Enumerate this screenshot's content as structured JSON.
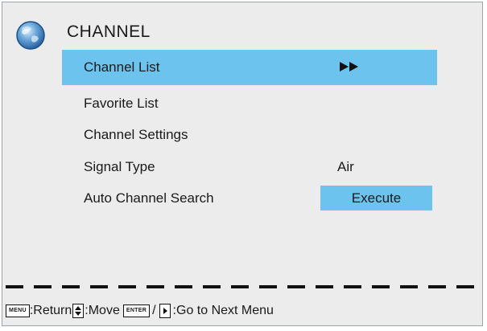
{
  "header": {
    "title": "CHANNEL",
    "icon": "globe-icon"
  },
  "menu": {
    "items": [
      {
        "label": "Channel List",
        "value": "",
        "selected": true,
        "indicator": "►►"
      },
      {
        "label": "Favorite List",
        "value": ""
      },
      {
        "label": "Channel Settings",
        "value": ""
      },
      {
        "label": "Signal Type",
        "value": "Air"
      },
      {
        "label": "Auto Channel Search",
        "value": "Execute"
      }
    ]
  },
  "footer": {
    "menu_key": "MENU",
    "return_label": ":Return",
    "move_label": ":Move",
    "enter_key": "ENTER",
    "slash": "/",
    "next_label": ":Go to Next Menu"
  },
  "colors": {
    "highlight": "#6cc4ee",
    "panel_bg": "#ececec",
    "dash": "#111111"
  }
}
